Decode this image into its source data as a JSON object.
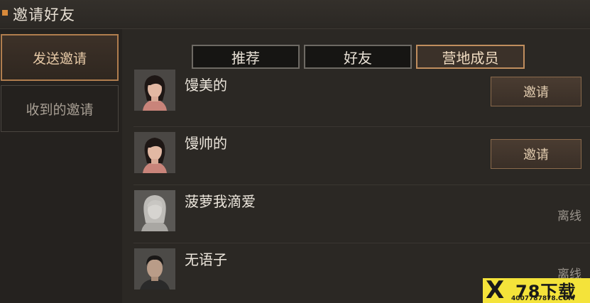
{
  "window": {
    "title": "邀请好友"
  },
  "sidebar": {
    "send_label": "发送邀请",
    "received_label": "收到的邀请"
  },
  "tabs": [
    {
      "label": "推荐",
      "active": false
    },
    {
      "label": "好友",
      "active": false
    },
    {
      "label": "营地成员",
      "active": true
    }
  ],
  "members": [
    {
      "name": "馒美的",
      "action": "邀请",
      "status": "",
      "avatar": "female-dark-hair-icon"
    },
    {
      "name": "馒帅的",
      "action": "邀请",
      "status": "",
      "avatar": "female-dark-hair-icon"
    },
    {
      "name": "菠萝我滴爱",
      "action": "",
      "status": "离线",
      "avatar": "grey-hair-portrait-icon"
    },
    {
      "name": "无语子",
      "action": "",
      "status": "离线",
      "avatar": "male-short-hair-icon"
    }
  ],
  "watermark": {
    "mark": "X",
    "brand": "78下载",
    "url": "4007787878.COM"
  },
  "colors": {
    "accent": "#c08e5e",
    "title_marker": "#d98a3a",
    "background": "#2a2723"
  }
}
